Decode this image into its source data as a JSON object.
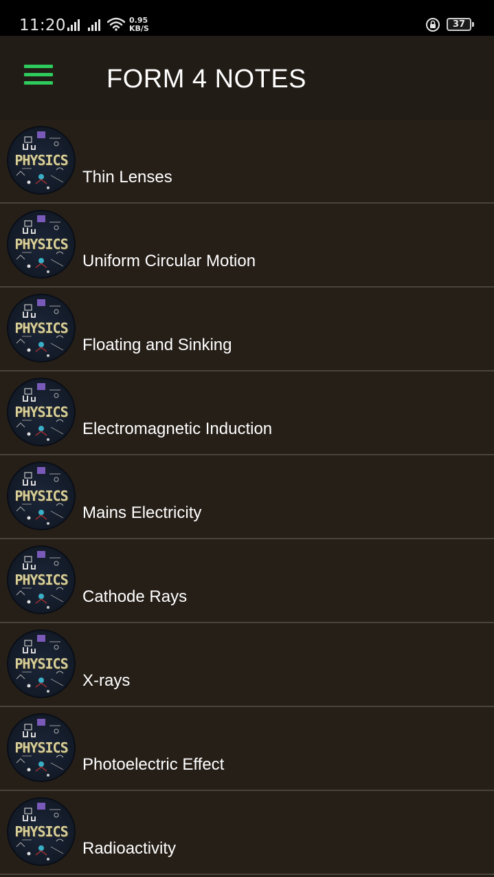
{
  "status_bar": {
    "time": "11:20",
    "speed_value": "0.95",
    "speed_unit": "KB/S",
    "battery": "37"
  },
  "app_bar": {
    "title": "FORM 4 NOTES",
    "menu_icon": "hamburger-menu-icon",
    "accent_color": "#2ecc5c"
  },
  "list": {
    "thumbnail_text": "PHYSICS",
    "items": [
      {
        "label": "Thin Lenses"
      },
      {
        "label": "Uniform Circular Motion"
      },
      {
        "label": "Floating and Sinking"
      },
      {
        "label": "Electromagnetic Induction"
      },
      {
        "label": "Mains Electricity"
      },
      {
        "label": "Cathode Rays"
      },
      {
        "label": "X-rays"
      },
      {
        "label": "Photoelectric Effect"
      },
      {
        "label": "Radioactivity"
      }
    ]
  }
}
